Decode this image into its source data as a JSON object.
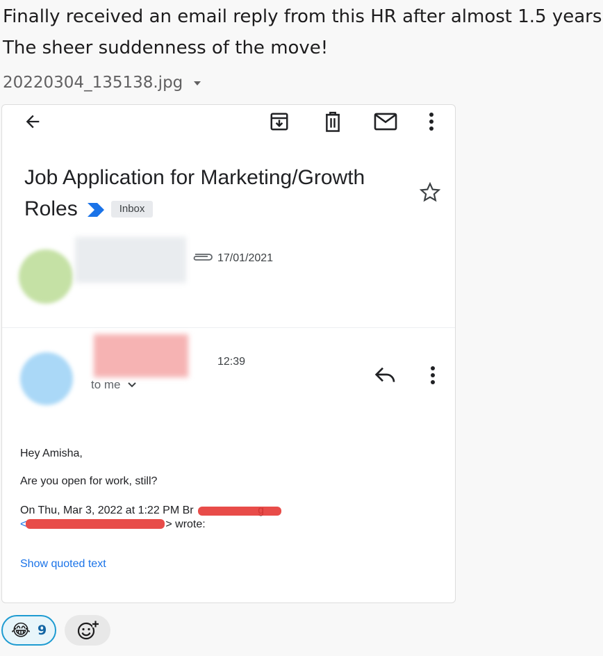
{
  "message": {
    "line1": "Finally received an email reply from this HR after almost 1.5 years",
    "line2": "The sheer suddenness of the move!"
  },
  "attachment": {
    "filename": "20220304_135138.jpg"
  },
  "email": {
    "toolbar_icons": [
      "back-arrow-icon",
      "archive-icon",
      "trash-icon",
      "mail-icon",
      "more-vert-icon"
    ],
    "subject_line1": "Job Application for Marketing/Growth",
    "subject_line2": "Roles",
    "label": "Inbox",
    "first_message": {
      "date": "17/01/2021"
    },
    "reply": {
      "time": "12:39",
      "recipient": "to me",
      "greeting": "Hey Amisha,",
      "body": "Are you open for work, still?",
      "quote_header": "On Thu, Mar 3, 2022 at 1:22 PM Br",
      "quote_header_end": "g",
      "quote_wrote": "> wrote:",
      "show_quoted": "Show quoted text"
    }
  },
  "reactions": [
    {
      "emoji": "😂",
      "count": "9"
    }
  ],
  "colors": {
    "accent": "#1d9bd1",
    "link": "#1a73e8",
    "redact": "#e53935"
  }
}
